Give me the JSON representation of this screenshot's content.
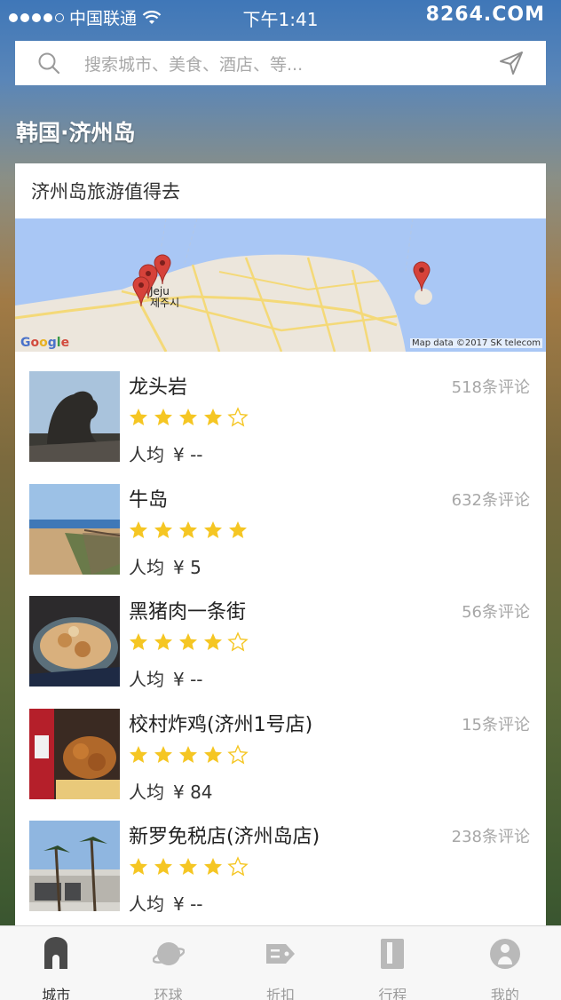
{
  "status_bar": {
    "carrier": "中国联通",
    "time": "下午1:41",
    "watermark": "8264.COM"
  },
  "search": {
    "placeholder": "搜索城市、美食、酒店、等..."
  },
  "region": {
    "title": "韩国·济州岛"
  },
  "card": {
    "header": "济州岛旅游值得去",
    "map": {
      "city_en": "Jeju",
      "city_ko": "제주시",
      "credit": "Map data ©2017 SK telecom",
      "logo": [
        "G",
        "o",
        "o",
        "g",
        "l",
        "e"
      ]
    }
  },
  "items": [
    {
      "name": "龙头岩",
      "reviews": "518条评论",
      "rating": 4,
      "price_label": "人均",
      "price": "¥ --"
    },
    {
      "name": "牛岛",
      "reviews": "632条评论",
      "rating": 5,
      "price_label": "人均",
      "price": "¥ 5"
    },
    {
      "name": "黑猪肉一条街",
      "reviews": "56条评论",
      "rating": 4,
      "price_label": "人均",
      "price": "¥ --"
    },
    {
      "name": "校村炸鸡(济州1号店)",
      "reviews": "15条评论",
      "rating": 4,
      "price_label": "人均",
      "price": "¥ 84"
    },
    {
      "name": "新罗免税店(济州岛店)",
      "reviews": "238条评论",
      "rating": 4,
      "price_label": "人均",
      "price": "¥ --"
    }
  ],
  "tabs": [
    {
      "label": "城市",
      "icon": "city-icon",
      "active": true
    },
    {
      "label": "环球",
      "icon": "planet-icon",
      "active": false
    },
    {
      "label": "折扣",
      "icon": "coupon-tag-icon",
      "active": false
    },
    {
      "label": "行程",
      "icon": "itinerary-book-icon",
      "active": false
    },
    {
      "label": "我的",
      "icon": "profile-icon",
      "active": false
    }
  ],
  "colors": {
    "star": "#f5c623",
    "star_empty": "#f5c623",
    "active_tab": "#333333",
    "inactive_tab": "#9b9b9b"
  }
}
